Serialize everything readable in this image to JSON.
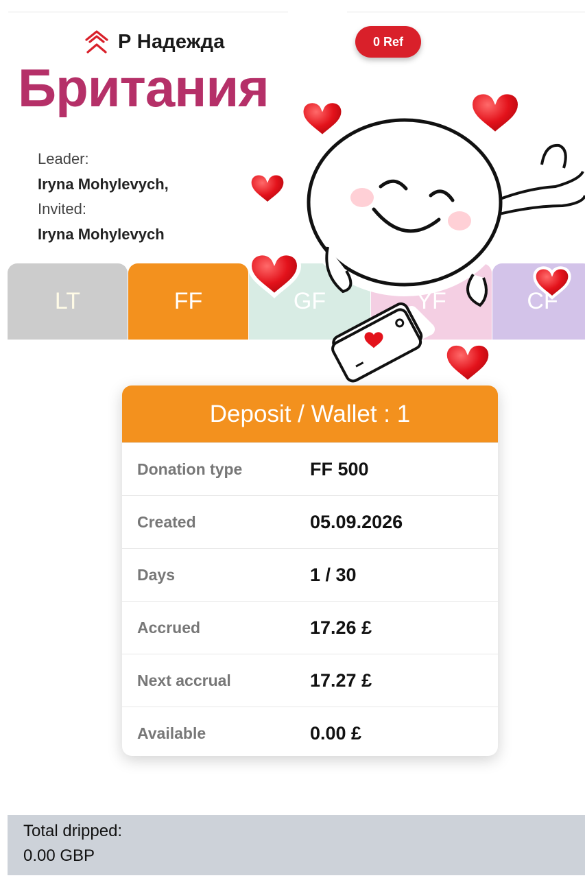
{
  "header": {
    "brand_name": "Р Надежда",
    "ref_button": "0 Ref",
    "country": "Британия"
  },
  "people": {
    "leader_label": "Leader:",
    "leader_name": "Iryna Mohylevych,",
    "invited_label": "Invited:",
    "invited_name": "Iryna Mohylevych"
  },
  "tabs": [
    {
      "label": "LT"
    },
    {
      "label": "FF"
    },
    {
      "label": "GF"
    },
    {
      "label": "YF"
    },
    {
      "label": "CF"
    }
  ],
  "deposit": {
    "title": "Deposit / Wallet : 1",
    "rows": [
      {
        "label": "Donation type",
        "value": "FF 500"
      },
      {
        "label": "Created",
        "value": "05.09.2026"
      },
      {
        "label": "Days",
        "value": "1 / 30"
      },
      {
        "label": "Accrued",
        "value": "17.26 £"
      },
      {
        "label": "Next accrual",
        "value": "17.27 £"
      },
      {
        "label": "Available",
        "value": "0.00 £"
      }
    ]
  },
  "footer": {
    "total_label": "Total dripped:",
    "total_value": "0.00 GBP"
  },
  "colors": {
    "accent_orange": "#f3911e",
    "brand_red": "#d9202a",
    "country_magenta": "#b53068"
  },
  "icons": {
    "brand_logo": "house-arrows-icon",
    "sticker": "smiling-ball-with-hearts-sticker"
  }
}
